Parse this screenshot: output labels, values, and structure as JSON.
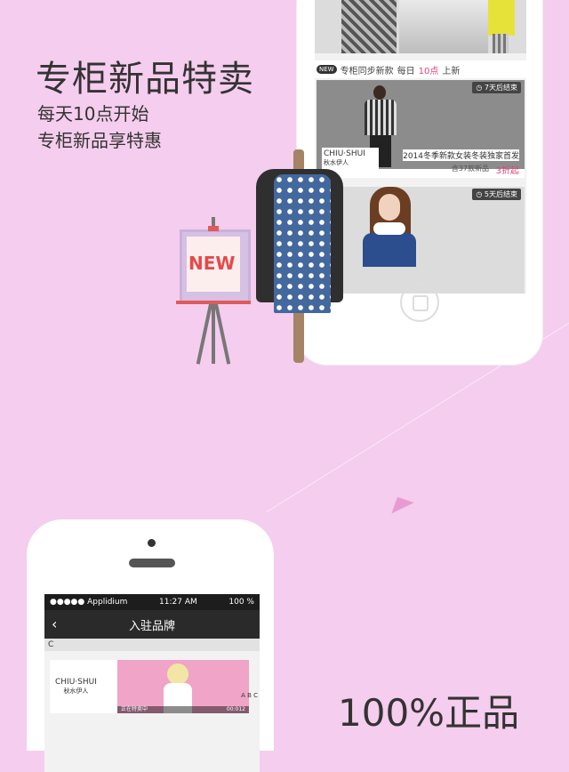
{
  "hero": {
    "title": "专柜新品特卖",
    "subtitle1": "每天10点开始",
    "subtitle2": "专柜新品享特惠"
  },
  "phone1": {
    "section": {
      "new_tag": "NEW",
      "text1": "专柜同步新款",
      "text2": "每日",
      "time": "10点",
      "text3": "上新"
    },
    "cards": [
      {
        "badge": "7天后结束",
        "brand": "CHIU·SHUI",
        "brand_cn": "秋水伊人",
        "title": "2014冬季新款女装冬装独家首发",
        "count": "含37款新品",
        "discount": "3折起"
      },
      {
        "badge": "5天后结束"
      }
    ]
  },
  "easel": {
    "sign": "NEW"
  },
  "phone2": {
    "status": {
      "carrier": "●●●●● Applidium ",
      "time": "11:27 AM",
      "battery": "100 %"
    },
    "nav": {
      "back": "‹",
      "title": "入驻品牌"
    },
    "letter": "C",
    "brand": {
      "logo": "CHIU·SHUI",
      "logo_cn": "秋水伊人",
      "strip_left": "正在特卖中",
      "strip_right": "00:012"
    },
    "index_letters": "A B C"
  },
  "bottom_text": "100%正品",
  "colors": {
    "background": "#f5cdee",
    "accent": "#e0457b",
    "new_red": "#e64949"
  }
}
